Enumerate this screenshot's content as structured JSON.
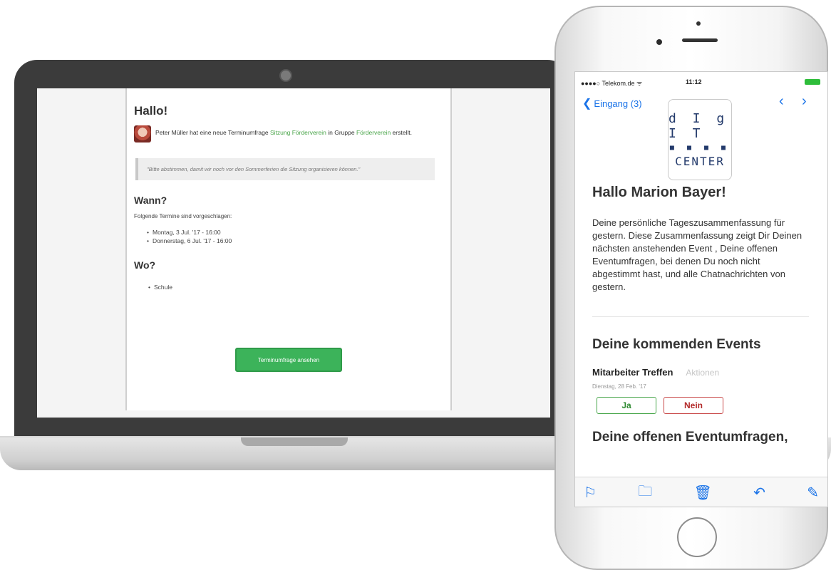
{
  "laptop_email": {
    "greeting": "Hallo!",
    "intro_pre": "Peter Müller hat eine neue Terminumfrage",
    "intro_link_poll": "Sitzung Förderverein",
    "intro_mid": "in Gruppe",
    "intro_link_group": "Förderverein",
    "intro_post": "erstellt.",
    "quote": "\"Bitte abstimmen, damit wir noch vor den Sommerferien die Sitzung organisieren können.\"",
    "when_heading": "Wann?",
    "when_text": "Folgende Termine sind vorgeschlagen:",
    "dates": [
      "Montag, 3 Jul. '17 - 16:00",
      "Donnerstag, 6 Jul. '17 - 16:00"
    ],
    "where_heading": "Wo?",
    "where_item": "Schule",
    "button_label": "Terminumfrage ansehen",
    "accent_color": "#3cb35a"
  },
  "phone": {
    "status": {
      "carrier": "●●●●○ Telekom.de ᯤ",
      "time": "11:12"
    },
    "nav": {
      "back_label": "Eingang (3)",
      "back_icon": "chevron-left-icon",
      "prev_icon": "chevron-left-icon",
      "next_icon": "chevron-right-icon"
    },
    "logo": {
      "line1": "d I g I T",
      "dots": "■ ■ ■ ■",
      "line2": "CENTER"
    },
    "email": {
      "greeting": "Hallo Marion Bayer!",
      "summary": "Deine persönliche Tageszusammenfassung für gestern. Diese Zusammenfassung zeigt Dir Deinen nächsten anstehenden Event , Deine offenen Eventumfragen, bei denen Du noch nicht abgestimmt hast, und alle Chatnachrichten von gestern.",
      "upcoming_heading": "Deine kommenden Events",
      "event_title": "Mitarbeiter Treffen",
      "event_action": "Aktionen",
      "event_date": "Dienstag, 28 Feb. '17",
      "yes_label": "Ja",
      "no_label": "Nein",
      "open_polls_heading": "Deine offenen Eventumfragen,"
    },
    "toolbar": [
      "flag-icon",
      "folder-icon",
      "trash-icon",
      "reply-icon",
      "compose-icon"
    ]
  }
}
